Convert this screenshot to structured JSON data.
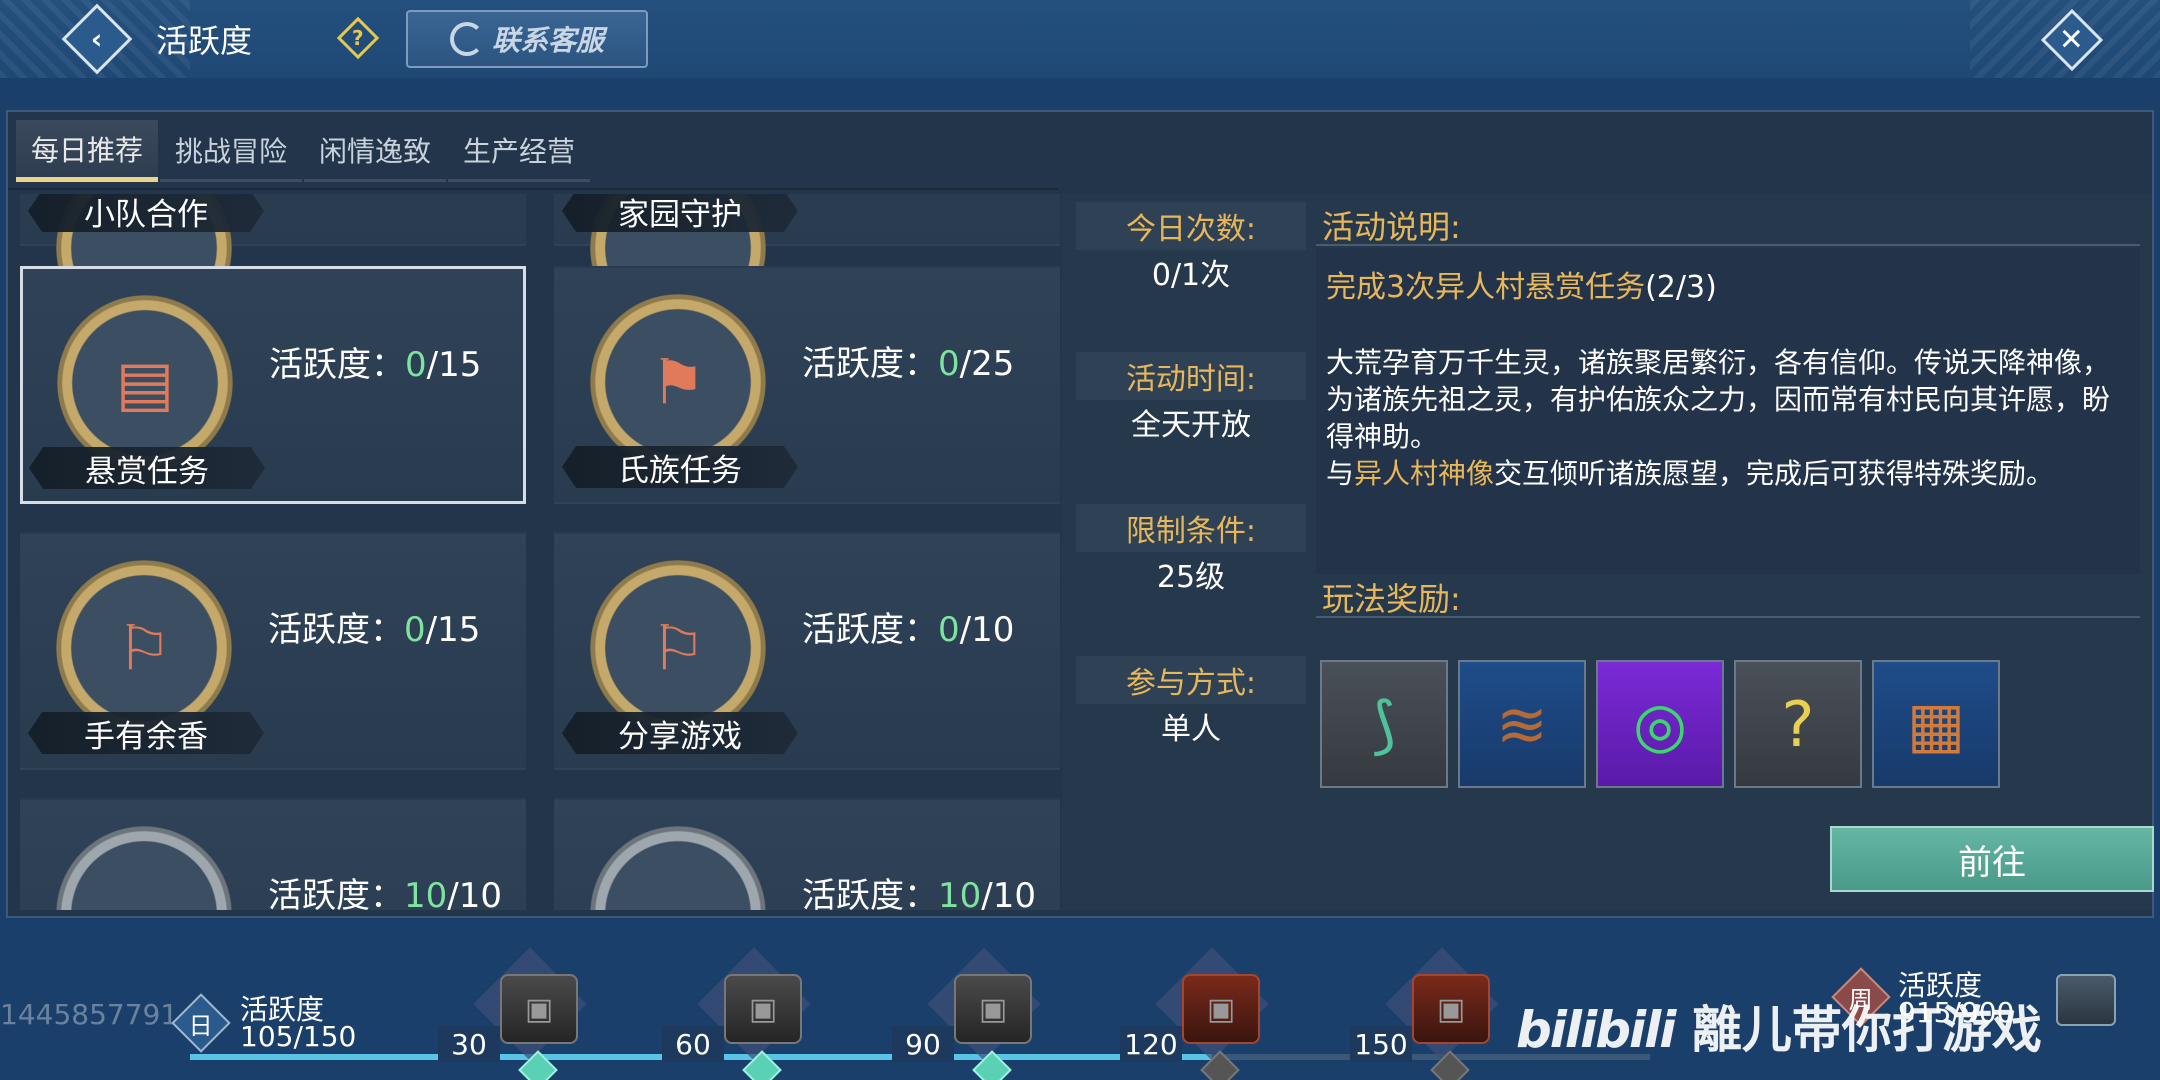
{
  "header": {
    "title": "活跃度",
    "help_glyph": "?",
    "customer_service_label": "联系客服",
    "back_glyph": "‹",
    "close_glyph": "✕"
  },
  "tabs": [
    {
      "label": "每日推荐",
      "active": true
    },
    {
      "label": "挑战冒险",
      "active": false
    },
    {
      "label": "闲情逸致",
      "active": false
    },
    {
      "label": "生产经营",
      "active": false
    }
  ],
  "activities": {
    "score_label": "活跃度：",
    "items": [
      {
        "name": "小队合作",
        "icon": "team-icon"
      },
      {
        "name": "家园守护",
        "icon": "home-icon"
      },
      {
        "name": "悬赏任务",
        "current": "0",
        "max": "/15",
        "icon": "bounty-board-icon"
      },
      {
        "name": "氏族任务",
        "current": "0",
        "max": "/25",
        "icon": "clan-banner-icon"
      },
      {
        "name": "手有余香",
        "current": "0",
        "max": "/15",
        "icon": "scroll-icon"
      },
      {
        "name": "分享游戏",
        "current": "0",
        "max": "/10",
        "icon": "scroll-icon"
      },
      {
        "current": "10",
        "max": "/10"
      },
      {
        "current": "10",
        "max": "/10"
      }
    ]
  },
  "detail": {
    "info": [
      {
        "label": "今日次数:",
        "value": "0/1次"
      },
      {
        "label": "活动时间:",
        "value": "全天开放"
      },
      {
        "label": "限制条件:",
        "value": "25级"
      },
      {
        "label": "参与方式:",
        "value": "单人"
      }
    ],
    "desc_title": "活动说明:",
    "task_text": "完成3次异人村悬赏任务",
    "task_count": "(2/3)",
    "body_text": "大荒孕育万千生灵，诸族聚居繁衍，各有信仰。传说天降神像，为诸族先祖之灵，有护佑族众之力，因而常有村民向其许愿，盼得神助。",
    "body_prefix": "与",
    "body_highlight": "异人村神像",
    "body_suffix": "交互倾听诸族愿望，完成后可获得特殊奖励。",
    "reward_title": "玩法奖励:",
    "rewards": [
      {
        "icon": "green-claw-icon",
        "glyph": "⟆"
      },
      {
        "icon": "brown-feather-icon",
        "glyph": "≋"
      },
      {
        "icon": "jade-ring-icon",
        "glyph": "◎"
      },
      {
        "icon": "mystery-stone-icon",
        "glyph": "?"
      },
      {
        "icon": "treasure-chest-icon",
        "glyph": "▦"
      }
    ],
    "go_button_label": "前往"
  },
  "footer": {
    "watermark_number": "1445857791",
    "day_badge": "日",
    "day_label": "活跃度",
    "day_value": "105/150",
    "progress": 0.7,
    "milestones": [
      {
        "value": "30",
        "reached": true
      },
      {
        "value": "60",
        "reached": true
      },
      {
        "value": "90",
        "reached": true
      },
      {
        "value": "120",
        "reached": false
      },
      {
        "value": "150",
        "reached": false
      }
    ],
    "week_badge": "周",
    "week_label": "活跃度",
    "week_value": "915/900",
    "watermark_brand": "bilibili",
    "watermark_text": "離儿帯你打游戏"
  },
  "colors": {
    "accent_gold": "#e8b75a",
    "score_green": "#7fe3a0",
    "button_teal": "#4a9a8a"
  }
}
